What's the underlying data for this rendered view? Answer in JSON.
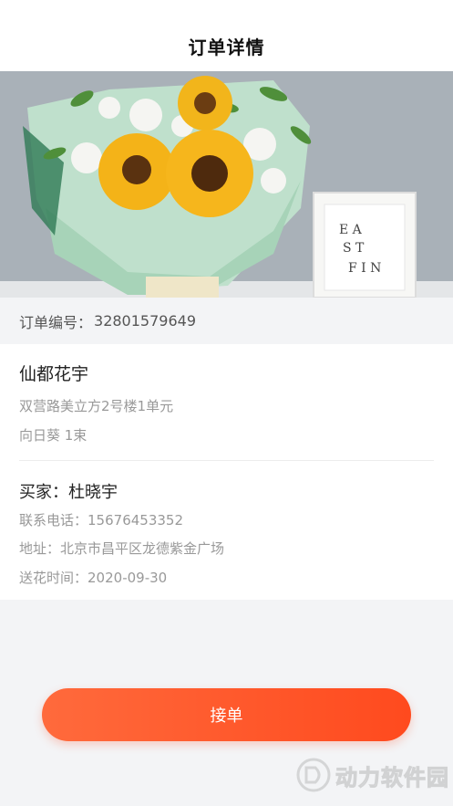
{
  "nav": {
    "title": "订单详情"
  },
  "hero": {
    "image_alt": "sunflower-bouquet-photo",
    "card_text": "EASTFIN"
  },
  "order": {
    "number_label": "订单编号：",
    "number_value": "32801579649"
  },
  "shop": {
    "name": "仙都花宇",
    "address": "双营路美立方2号楼1单元",
    "product": "向日葵 1束"
  },
  "buyer": {
    "label": "买家：",
    "name": "杜晓宇",
    "phone_label": "联系电话：",
    "phone": "15676453352",
    "address_label": "地址：",
    "address": "北京市昌平区龙德紫金广场",
    "time_label": "送花时间：",
    "time": "2020-09-30"
  },
  "actions": {
    "accept_label": "接单"
  },
  "watermark": {
    "text": "动力软件园"
  },
  "colors": {
    "accent": "#ff5a2c",
    "background": "#f3f4f6"
  }
}
